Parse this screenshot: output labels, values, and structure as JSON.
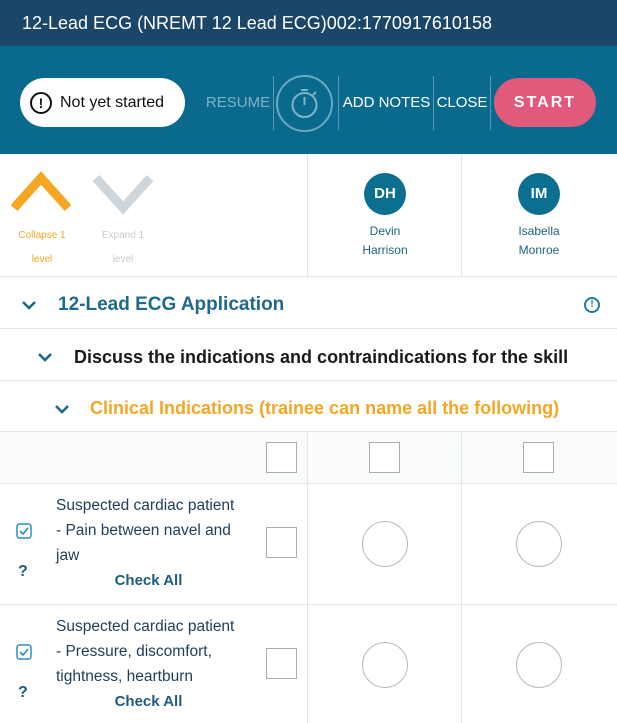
{
  "header": {
    "title": "12-Lead ECG (NREMT 12 Lead ECG)002:1770917610158"
  },
  "toolbar": {
    "status": "Not yet started",
    "status_icon": "alert-circle-icon",
    "resume_label": "RESUME",
    "timer_icon": "stopwatch-icon",
    "add_notes_label": "ADD NOTES",
    "close_label": "CLOSE",
    "start_label": "START",
    "colors": {
      "bar": "#0a6a8e",
      "title_bar": "#1b4668",
      "start": "#e15a7b"
    }
  },
  "levels": {
    "collapse_label": "Collapse 1 level",
    "collapse_label_line1": "Collapse 1",
    "collapse_label_line2": "level",
    "expand_label_line1": "Expand 1",
    "expand_label_line2": "level",
    "collapse_color": "#f5a623",
    "expand_color": "#cfd6db"
  },
  "trainees": [
    {
      "initials": "DH",
      "first": "Devin",
      "last": "Harrison"
    },
    {
      "initials": "IM",
      "first": "Isabella",
      "last": "Monroe"
    }
  ],
  "sections": {
    "level1": {
      "title": "12-Lead ECG Application",
      "icon": "alert-circle-icon"
    },
    "level2": {
      "title": "Discuss the indications and contraindications for the skill"
    },
    "level3": {
      "title": "Clinical Indications (trainee can name all the following)",
      "color": "#f5a623"
    }
  },
  "items": [
    {
      "lines": [
        "Suspected cardiac patient",
        "- Pain between navel and",
        "jaw"
      ],
      "check_all": "Check All",
      "help": "?"
    },
    {
      "lines": [
        "Suspected cardiac patient",
        "- Pressure, discomfort,",
        "tightness, heartburn"
      ],
      "check_all": "Check All",
      "help": "?"
    }
  ]
}
